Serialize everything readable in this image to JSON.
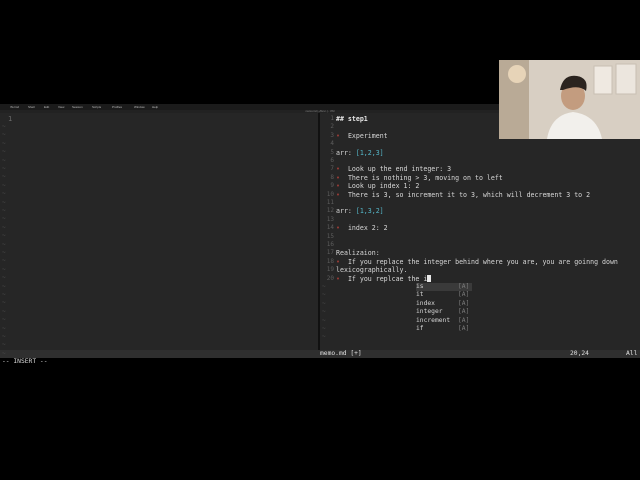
{
  "menubar": {
    "items": [
      "iTerm2",
      "Shell",
      "Edit",
      "View",
      "Session",
      "Scripts",
      "Profiles",
      "Window",
      "Help"
    ]
  },
  "window_title": "memo.md (~/Dev/..) - VIM",
  "left_pane": {
    "line_number": "1"
  },
  "editor": {
    "lines": [
      {
        "n": "1",
        "text": "## step1",
        "cls": "heading"
      },
      {
        "n": "2",
        "text": ""
      },
      {
        "n": "3",
        "text": "Experiment",
        "bullet": "•"
      },
      {
        "n": "4",
        "text": ""
      },
      {
        "n": "5",
        "pre": "arr: ",
        "bracket": "[1,2,3]"
      },
      {
        "n": "6",
        "text": ""
      },
      {
        "n": "7",
        "text": "Look up the end integer: 3",
        "bullet": "•"
      },
      {
        "n": "8",
        "text": "There is nothing > 3, moving on to left",
        "bullet": "•"
      },
      {
        "n": "9",
        "text": "Look up index 1: 2",
        "bullet": "•"
      },
      {
        "n": "10",
        "text": "There is 3, so increment it to 3, which will decrement 3 to 2",
        "bullet": "•"
      },
      {
        "n": "11",
        "text": ""
      },
      {
        "n": "12",
        "pre": "arr: ",
        "bracket": "[1,3,2]"
      },
      {
        "n": "13",
        "text": ""
      },
      {
        "n": "14",
        "text": "index 2: 2",
        "bullet": "•"
      },
      {
        "n": "15",
        "text": ""
      },
      {
        "n": "16",
        "text": ""
      },
      {
        "n": "17",
        "text": "Realizaion:"
      },
      {
        "n": "18",
        "text": "If you replace the integer behind where you are, you are goinng down",
        "bullet": "•"
      },
      {
        "n": "19",
        "text": "lexicographically."
      },
      {
        "n": "20",
        "text": "If you replcae the i",
        "bullet": "•",
        "cursor": true
      }
    ]
  },
  "completion_popup": {
    "items": [
      {
        "label": "is",
        "kind": "[A]",
        "selected": true
      },
      {
        "label": "it",
        "kind": "[A]"
      },
      {
        "label": "index",
        "kind": "[A]"
      },
      {
        "label": "integer",
        "kind": "[A]"
      },
      {
        "label": "increment",
        "kind": "[A]"
      },
      {
        "label": "if",
        "kind": "[A]"
      }
    ]
  },
  "statusline": {
    "filename": "memo.md [+]",
    "position": "20,24",
    "scroll": "All"
  },
  "mode_line": "-- INSERT --",
  "colors": {
    "bracket": "#55b7c9",
    "bullet": "#9c3c36",
    "background": "#262626"
  }
}
